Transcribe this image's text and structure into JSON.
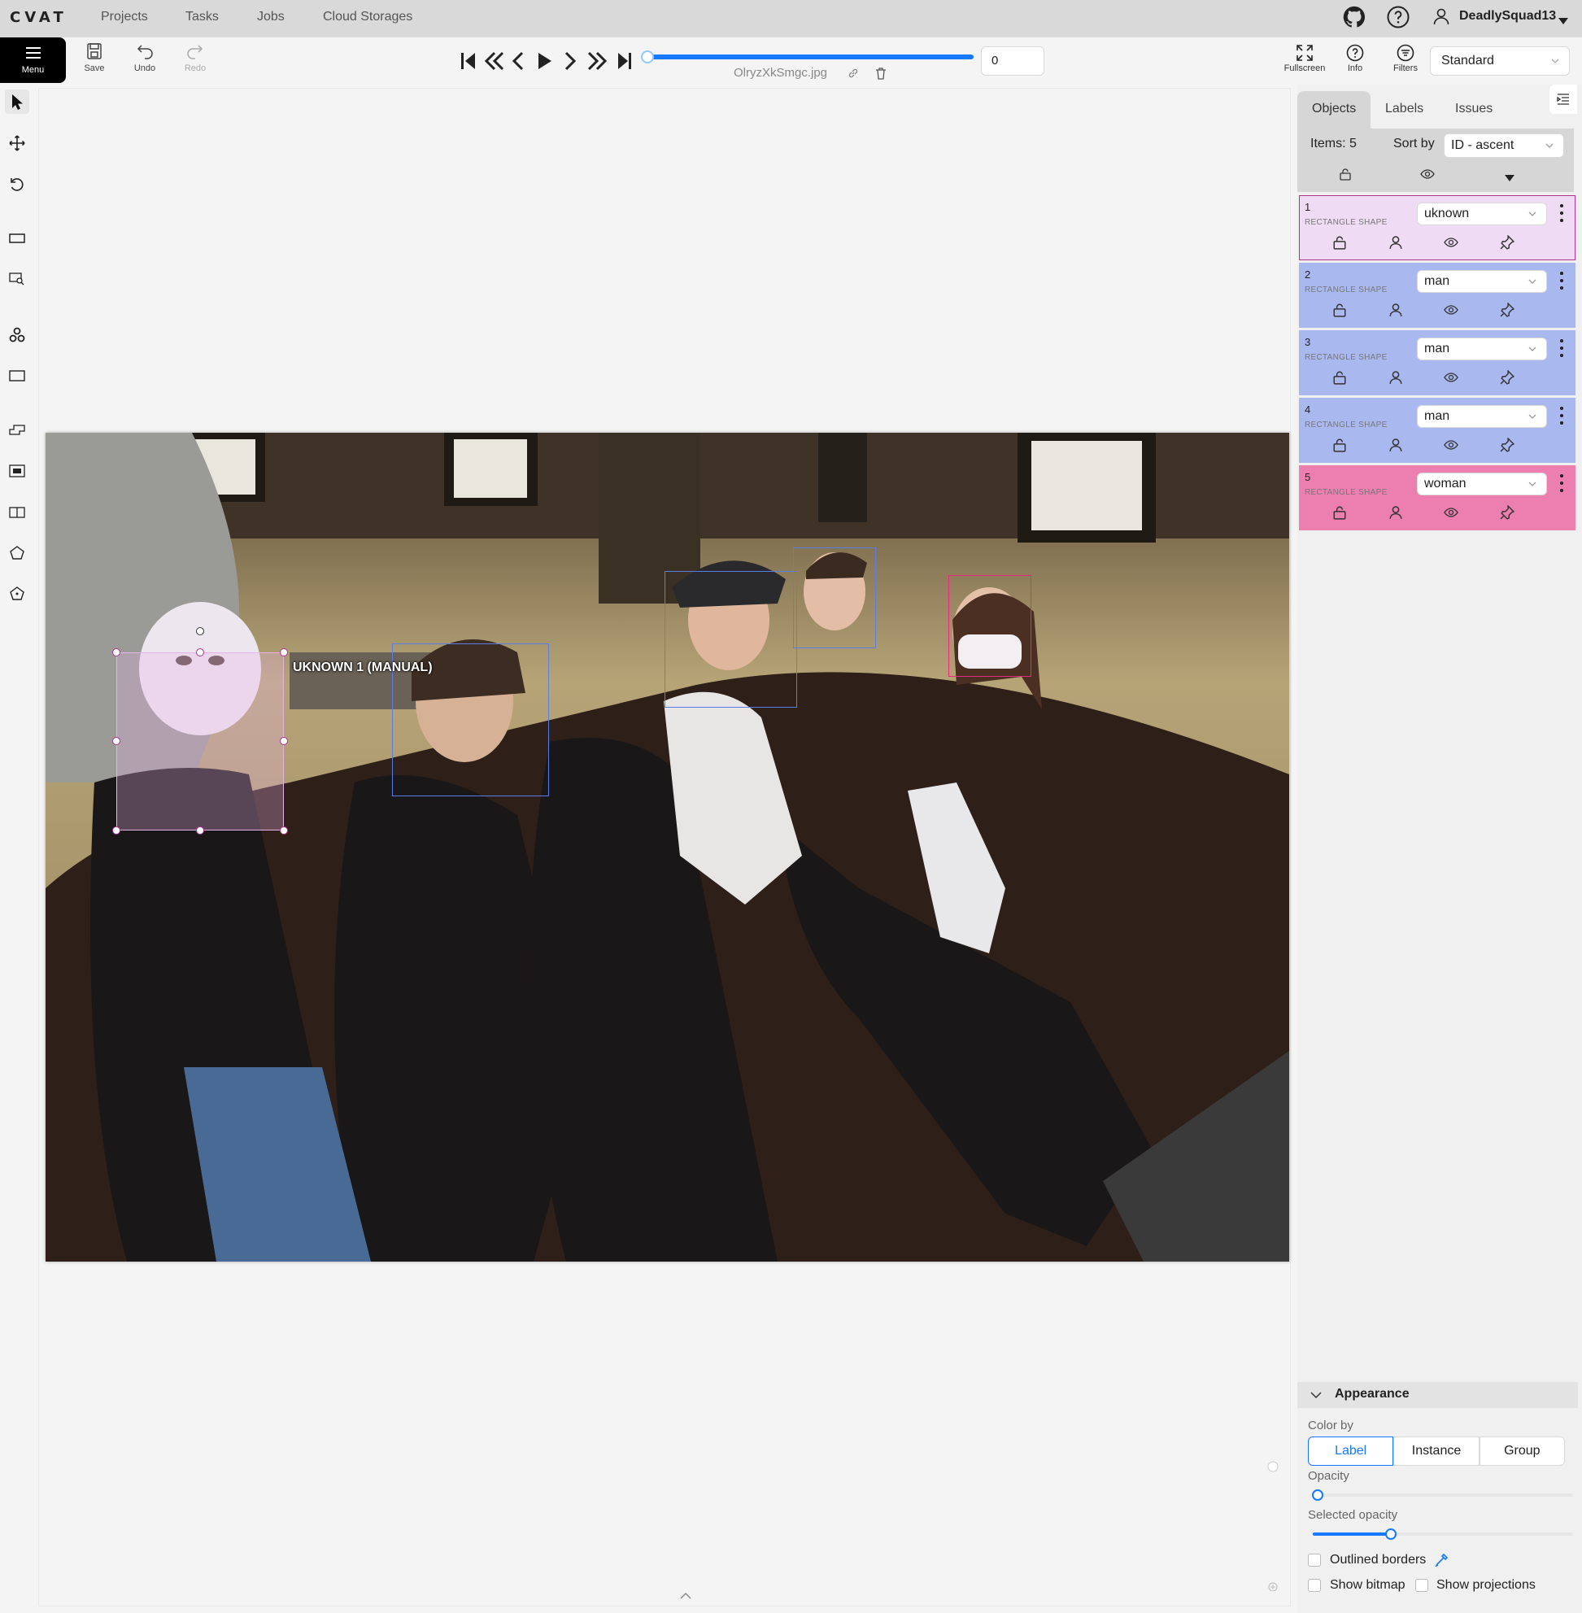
{
  "app": {
    "logo": "CVAT",
    "nav": [
      "Projects",
      "Tasks",
      "Jobs",
      "Cloud Storages"
    ],
    "username": "DeadlySquad13"
  },
  "toolbar": {
    "menu_label": "Menu",
    "save_label": "Save",
    "undo_label": "Undo",
    "redo_label": "Redo",
    "frame_number": "0",
    "filename": "OlryzXkSmgc.jpg",
    "fullscreen_label": "Fullscreen",
    "info_label": "Info",
    "filters_label": "Filters",
    "workspace": "Standard"
  },
  "canvas": {
    "selected_label": "UKNOWN 1 (MANUAL)",
    "boxes": [
      {
        "id": 1,
        "label": "uknown",
        "color": "#e7b2e8"
      },
      {
        "id": 2,
        "label": "man",
        "color": "#5b7de6"
      },
      {
        "id": 3,
        "label": "man",
        "color": "#5b7de6"
      },
      {
        "id": 4,
        "label": "man",
        "color": "#5b7de6"
      },
      {
        "id": 5,
        "label": "woman",
        "color": "#e8297f"
      }
    ]
  },
  "sidebar": {
    "tabs": [
      "Objects",
      "Labels",
      "Issues"
    ],
    "items_count": "Items: 5",
    "sort_by_label": "Sort by",
    "sort_by_value": "ID - ascent",
    "objects": [
      {
        "id": "1",
        "type": "RECTANGLE SHAPE",
        "label": "uknown",
        "bg": "#efdbf3",
        "border": "#b0328f"
      },
      {
        "id": "2",
        "type": "RECTANGLE SHAPE",
        "label": "man",
        "bg": "#aab8f0",
        "border": "#aab8f0"
      },
      {
        "id": "3",
        "type": "RECTANGLE SHAPE",
        "label": "man",
        "bg": "#aab8f0",
        "border": "#aab8f0"
      },
      {
        "id": "4",
        "type": "RECTANGLE SHAPE",
        "label": "man",
        "bg": "#aab8f0",
        "border": "#aab8f0"
      },
      {
        "id": "5",
        "type": "RECTANGLE SHAPE",
        "label": "woman",
        "bg": "#ec7fb0",
        "border": "#ec7fb0"
      }
    ],
    "appearance": {
      "title": "Appearance",
      "color_by_label": "Color by",
      "color_by_options": [
        "Label",
        "Instance",
        "Group"
      ],
      "color_by_selected": "Label",
      "opacity_label": "Opacity",
      "opacity_value": 0.02,
      "selected_opacity_label": "Selected opacity",
      "selected_opacity_value": 0.3,
      "outlined_borders_label": "Outlined borders",
      "show_bitmap_label": "Show bitmap",
      "show_projections_label": "Show projections"
    }
  }
}
